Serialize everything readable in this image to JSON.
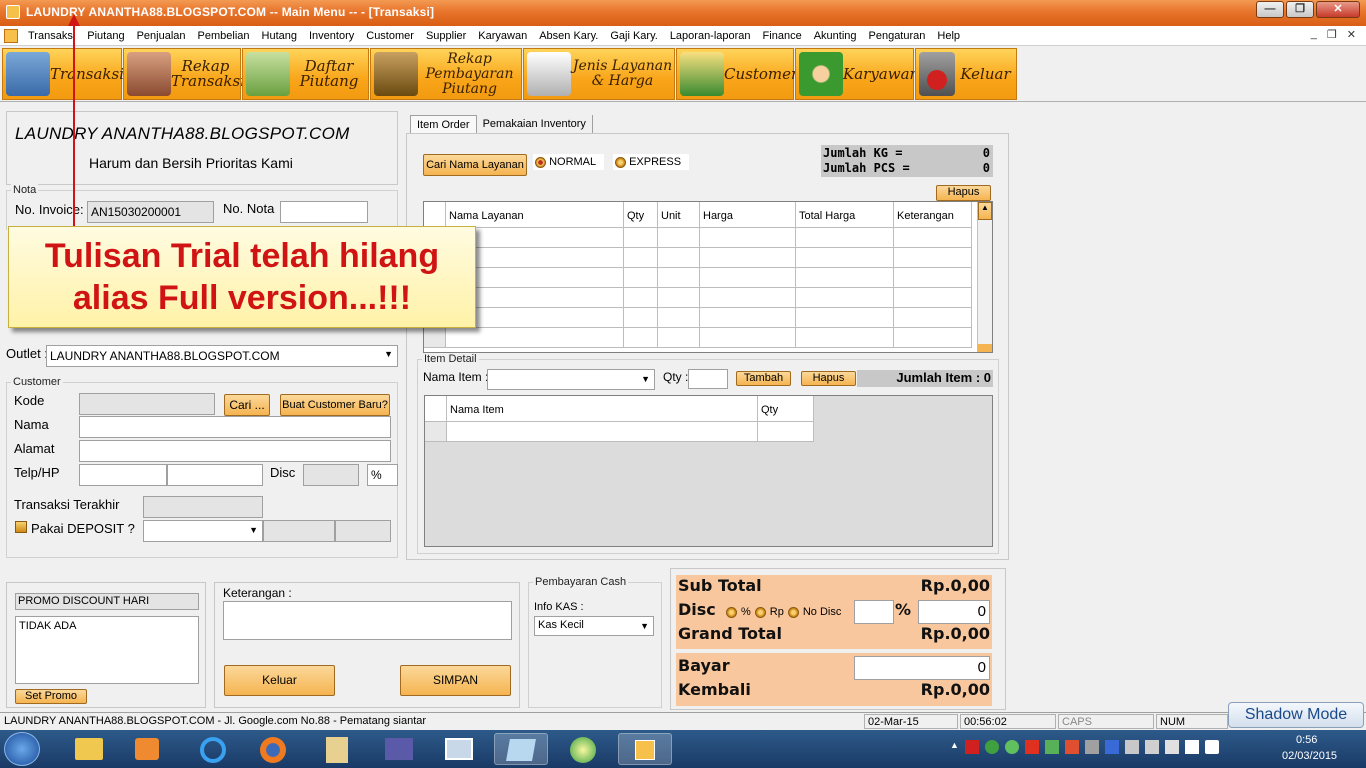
{
  "window": {
    "title": "LAUNDRY ANANTHA88.BLOGSPOT.COM  -- Main Menu -- - [Transaksi]",
    "minimize": "—",
    "restore": "❐",
    "close": "✕"
  },
  "menu": [
    "Transaksi",
    "Piutang",
    "Penjualan",
    "Pembelian",
    "Hutang",
    "Inventory",
    "Customer",
    "Supplier",
    "Karyawan",
    "Absen Kary.",
    "Gaji Kary.",
    "Laporan-laporan",
    "Finance",
    "Akunting",
    "Pengaturan",
    "Help"
  ],
  "mdi_controls": {
    "min": "_",
    "restore": "❐",
    "close": "✕"
  },
  "toolbar": [
    "Transaksi",
    "Rekap Transaksi",
    "Daftar Piutang",
    "Rekap Pembayaran Piutang",
    "Jenis Layanan & Harga",
    "Customer",
    "Karyawan",
    "Keluar"
  ],
  "header": {
    "company": "LAUNDRY ANANTHA88.BLOGSPOT.COM",
    "slogan": "Harum dan Bersih Prioritas Kami"
  },
  "nota": {
    "legend": "Nota",
    "invoice_label": "No. Invoice:",
    "invoice_value": "AN15030200001",
    "nota_label": "No. Nota"
  },
  "callout": {
    "line1": "Tulisan Trial telah hilang",
    "line2": "alias Full version...!!!"
  },
  "outlet": {
    "label": "Outlet :",
    "value": "LAUNDRY ANANTHA88.BLOGSPOT.COM"
  },
  "customer": {
    "legend": "Customer",
    "kode": "Kode",
    "nama": "Nama",
    "alamat": "Alamat",
    "telp": "Telp/HP",
    "disc": "Disc",
    "pct": "%",
    "cari": "Cari ...",
    "buat": "Buat Customer Baru?",
    "transaksi_terakhir": "Transaksi Terakhir",
    "deposit": "Pakai DEPOSIT ?"
  },
  "tabs": [
    "Item Order",
    "Pemakaian Inventory"
  ],
  "order": {
    "cari_button": "Cari Nama Layanan",
    "normal": "NORMAL",
    "express": "EXPRESS",
    "jumlah_kg_label": "Jumlah KG =",
    "jumlah_kg": "0",
    "jumlah_pcs_label": "Jumlah PCS =",
    "jumlah_pcs": "0",
    "hapus": "Hapus"
  },
  "order_columns": [
    "Nama Layanan",
    "Qty",
    "Unit",
    "Harga",
    "Total Harga",
    "Keterangan"
  ],
  "item_detail": {
    "legend": "Item Detail",
    "nama_item": "Nama Item :",
    "qty": "Qty :",
    "tambah": "Tambah",
    "hapus": "Hapus",
    "jumlah_item": "Jumlah Item : 0",
    "col_nama": "Nama Item",
    "col_qty": "Qty"
  },
  "promo": {
    "title": "PROMO DISCOUNT HARI",
    "value": "TIDAK ADA",
    "button": "Set Promo"
  },
  "keterangan": {
    "label": "Keterangan :",
    "keluar": "Keluar",
    "simpan": "SIMPAN"
  },
  "payment": {
    "legend": "Pembayaran Cash",
    "info_kas": "Info KAS :",
    "kas": "Kas Kecil"
  },
  "totals": {
    "sub_total": "Sub Total",
    "sub_total_val": "Rp.0,00",
    "disc": "Disc",
    "opt_pct": "%",
    "opt_rp": "Rp",
    "opt_nodisc": "No Disc",
    "pct_sign": "%",
    "disc_val": "0",
    "grand_total": "Grand Total",
    "grand_total_val": "Rp.0,00",
    "bayar": "Bayar",
    "bayar_val": "0",
    "kembali": "Kembali",
    "kembali_val": "Rp.0,00"
  },
  "statusbar": {
    "info": "LAUNDRY ANANTHA88.BLOGSPOT.COM - Jl. Google.com No.88 - Pematang siantar",
    "date": "02-Mar-15",
    "time": "00:56:02",
    "caps": "CAPS",
    "num": "NUM",
    "shadow": "Shadow Mode"
  },
  "clock": {
    "time": "0:56",
    "date": "02/03/2015"
  },
  "colors": {
    "titlebar": "#e8742c",
    "toolbar_button": "#f9a51a",
    "totals_bg": "#f9c79e",
    "callout_text": "#d01414"
  }
}
